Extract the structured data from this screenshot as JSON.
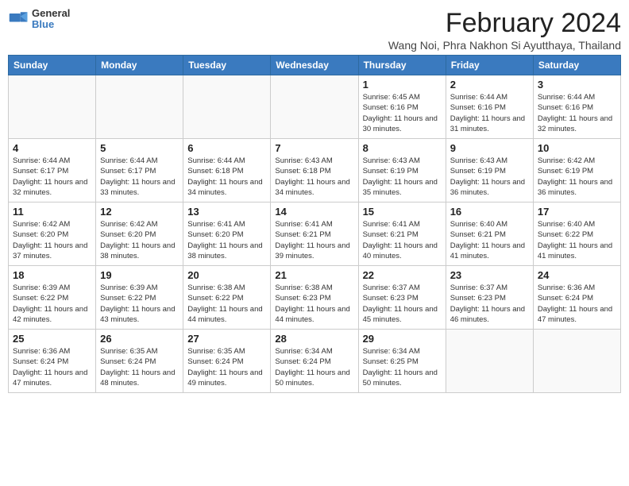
{
  "header": {
    "logo_general": "General",
    "logo_blue": "Blue",
    "title": "February 2024",
    "subtitle": "Wang Noi, Phra Nakhon Si Ayutthaya, Thailand"
  },
  "columns": [
    "Sunday",
    "Monday",
    "Tuesday",
    "Wednesday",
    "Thursday",
    "Friday",
    "Saturday"
  ],
  "weeks": [
    [
      {
        "day": "",
        "info": ""
      },
      {
        "day": "",
        "info": ""
      },
      {
        "day": "",
        "info": ""
      },
      {
        "day": "",
        "info": ""
      },
      {
        "day": "1",
        "info": "Sunrise: 6:45 AM\nSunset: 6:16 PM\nDaylight: 11 hours and 30 minutes."
      },
      {
        "day": "2",
        "info": "Sunrise: 6:44 AM\nSunset: 6:16 PM\nDaylight: 11 hours and 31 minutes."
      },
      {
        "day": "3",
        "info": "Sunrise: 6:44 AM\nSunset: 6:16 PM\nDaylight: 11 hours and 32 minutes."
      }
    ],
    [
      {
        "day": "4",
        "info": "Sunrise: 6:44 AM\nSunset: 6:17 PM\nDaylight: 11 hours and 32 minutes."
      },
      {
        "day": "5",
        "info": "Sunrise: 6:44 AM\nSunset: 6:17 PM\nDaylight: 11 hours and 33 minutes."
      },
      {
        "day": "6",
        "info": "Sunrise: 6:44 AM\nSunset: 6:18 PM\nDaylight: 11 hours and 34 minutes."
      },
      {
        "day": "7",
        "info": "Sunrise: 6:43 AM\nSunset: 6:18 PM\nDaylight: 11 hours and 34 minutes."
      },
      {
        "day": "8",
        "info": "Sunrise: 6:43 AM\nSunset: 6:19 PM\nDaylight: 11 hours and 35 minutes."
      },
      {
        "day": "9",
        "info": "Sunrise: 6:43 AM\nSunset: 6:19 PM\nDaylight: 11 hours and 36 minutes."
      },
      {
        "day": "10",
        "info": "Sunrise: 6:42 AM\nSunset: 6:19 PM\nDaylight: 11 hours and 36 minutes."
      }
    ],
    [
      {
        "day": "11",
        "info": "Sunrise: 6:42 AM\nSunset: 6:20 PM\nDaylight: 11 hours and 37 minutes."
      },
      {
        "day": "12",
        "info": "Sunrise: 6:42 AM\nSunset: 6:20 PM\nDaylight: 11 hours and 38 minutes."
      },
      {
        "day": "13",
        "info": "Sunrise: 6:41 AM\nSunset: 6:20 PM\nDaylight: 11 hours and 38 minutes."
      },
      {
        "day": "14",
        "info": "Sunrise: 6:41 AM\nSunset: 6:21 PM\nDaylight: 11 hours and 39 minutes."
      },
      {
        "day": "15",
        "info": "Sunrise: 6:41 AM\nSunset: 6:21 PM\nDaylight: 11 hours and 40 minutes."
      },
      {
        "day": "16",
        "info": "Sunrise: 6:40 AM\nSunset: 6:21 PM\nDaylight: 11 hours and 41 minutes."
      },
      {
        "day": "17",
        "info": "Sunrise: 6:40 AM\nSunset: 6:22 PM\nDaylight: 11 hours and 41 minutes."
      }
    ],
    [
      {
        "day": "18",
        "info": "Sunrise: 6:39 AM\nSunset: 6:22 PM\nDaylight: 11 hours and 42 minutes."
      },
      {
        "day": "19",
        "info": "Sunrise: 6:39 AM\nSunset: 6:22 PM\nDaylight: 11 hours and 43 minutes."
      },
      {
        "day": "20",
        "info": "Sunrise: 6:38 AM\nSunset: 6:22 PM\nDaylight: 11 hours and 44 minutes."
      },
      {
        "day": "21",
        "info": "Sunrise: 6:38 AM\nSunset: 6:23 PM\nDaylight: 11 hours and 44 minutes."
      },
      {
        "day": "22",
        "info": "Sunrise: 6:37 AM\nSunset: 6:23 PM\nDaylight: 11 hours and 45 minutes."
      },
      {
        "day": "23",
        "info": "Sunrise: 6:37 AM\nSunset: 6:23 PM\nDaylight: 11 hours and 46 minutes."
      },
      {
        "day": "24",
        "info": "Sunrise: 6:36 AM\nSunset: 6:24 PM\nDaylight: 11 hours and 47 minutes."
      }
    ],
    [
      {
        "day": "25",
        "info": "Sunrise: 6:36 AM\nSunset: 6:24 PM\nDaylight: 11 hours and 47 minutes."
      },
      {
        "day": "26",
        "info": "Sunrise: 6:35 AM\nSunset: 6:24 PM\nDaylight: 11 hours and 48 minutes."
      },
      {
        "day": "27",
        "info": "Sunrise: 6:35 AM\nSunset: 6:24 PM\nDaylight: 11 hours and 49 minutes."
      },
      {
        "day": "28",
        "info": "Sunrise: 6:34 AM\nSunset: 6:24 PM\nDaylight: 11 hours and 50 minutes."
      },
      {
        "day": "29",
        "info": "Sunrise: 6:34 AM\nSunset: 6:25 PM\nDaylight: 11 hours and 50 minutes."
      },
      {
        "day": "",
        "info": ""
      },
      {
        "day": "",
        "info": ""
      }
    ]
  ]
}
